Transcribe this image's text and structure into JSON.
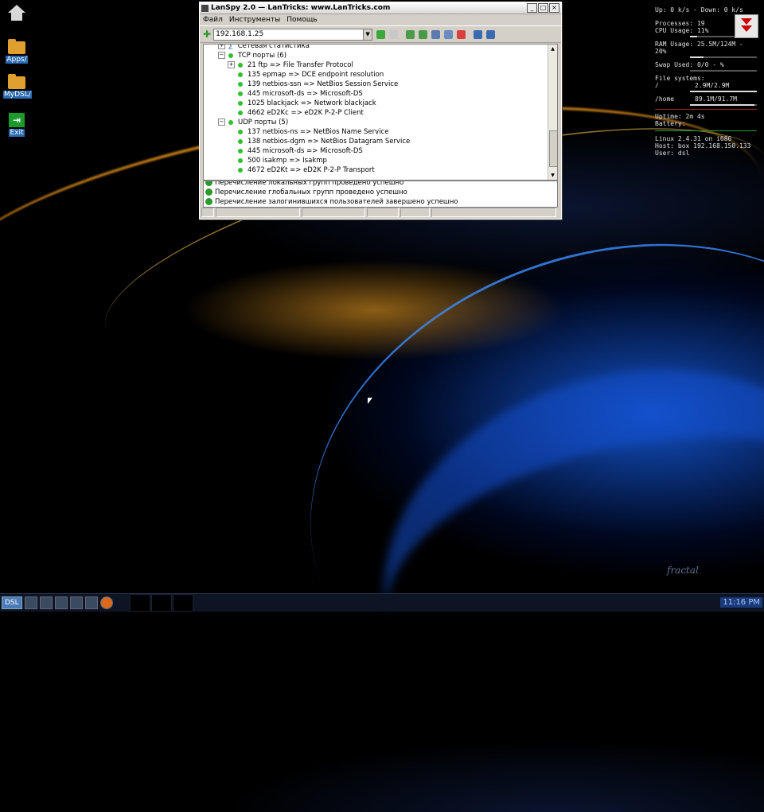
{
  "desktop": {
    "icons": [
      {
        "label": ""
      },
      {
        "label": "Apps/"
      },
      {
        "label": "MyDSL/"
      },
      {
        "label": "Exit"
      }
    ]
  },
  "window": {
    "title": "LanSpy 2.0 — LanTricks: www.LanTricks.com",
    "menu": [
      "Файл",
      "Инструменты",
      "Помощь"
    ],
    "address": "192.168.1.25",
    "tree": [
      {
        "indent": 1,
        "exp": "+",
        "dot": false,
        "text": "Сетевая статистика"
      },
      {
        "indent": 1,
        "exp": "−",
        "dot": true,
        "text": "TCP порты (6)"
      },
      {
        "indent": 2,
        "exp": "+",
        "dot": true,
        "text": "21 ftp => File Transfer Protocol"
      },
      {
        "indent": 2,
        "exp": "",
        "dot": true,
        "text": "135 epmap => DCE endpoint resolution"
      },
      {
        "indent": 2,
        "exp": "",
        "dot": true,
        "text": "139 netbios-ssn => NetBios Session Service"
      },
      {
        "indent": 2,
        "exp": "",
        "dot": true,
        "text": "445 microsoft-ds => Microsoft-DS"
      },
      {
        "indent": 2,
        "exp": "",
        "dot": true,
        "text": "1025 blackjack => Network blackjack"
      },
      {
        "indent": 2,
        "exp": "",
        "dot": true,
        "text": "4662 eD2Kc => eD2K P-2-P Client"
      },
      {
        "indent": 1,
        "exp": "−",
        "dot": true,
        "text": "UDP порты (5)"
      },
      {
        "indent": 2,
        "exp": "",
        "dot": true,
        "text": "137 netbios-ns => NetBios Name Service"
      },
      {
        "indent": 2,
        "exp": "",
        "dot": true,
        "text": "138 netbios-dgm => NetBios Datagram Service"
      },
      {
        "indent": 2,
        "exp": "",
        "dot": true,
        "text": "445 microsoft-ds => Microsoft-DS"
      },
      {
        "indent": 2,
        "exp": "",
        "dot": true,
        "text": "500 isakmp => Isakmp"
      },
      {
        "indent": 2,
        "exp": "",
        "dot": true,
        "text": "4672 eD2Kt => eD2K P-2-P Transport"
      }
    ],
    "log": [
      "Перечисление локальных групп проведено успешно",
      "Перечисление глобальных групп проведено успешно",
      "Перечисление залогинившихся пользователей завершено успешно"
    ]
  },
  "monitor": {
    "net": "Up: 0 k/s - Down: 0 k/s",
    "processes": "Processes: 19",
    "cpu": "CPU Usage: 11%",
    "cpu_fraction": 0.11,
    "ram": "RAM Usage: 25.5M/124M - 20%",
    "ram_fraction": 0.2,
    "swap": "Swap Used: 0/0 - %",
    "fs_header": "File systems:",
    "fs_root_label": "/",
    "fs_root_value": "2.9M/2.9M",
    "fs_root_fraction": 1.0,
    "fs_home_label": "/home",
    "fs_home_value": "89.1M/91.7M",
    "fs_home_fraction": 0.97,
    "uptime": "Uptime:     2m 4s",
    "battery": "Battery:",
    "linux": "Linux 2.4.31 on i686",
    "host": "Host: box 192.168.150.133",
    "user": "User: dsl"
  },
  "taskbar": {
    "start": "DSL",
    "clock": "11:16 PM"
  },
  "watermark": "fractal"
}
